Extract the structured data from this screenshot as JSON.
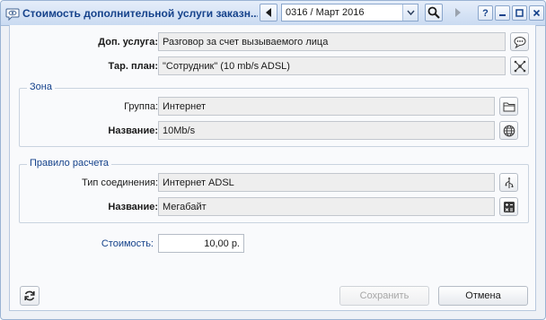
{
  "window": {
    "title": "Стоимость дополнительной услуги заказн...",
    "period_combo_value": "0316 / Март 2016",
    "help_label": "?"
  },
  "form": {
    "service_label": "Доп. услуга:",
    "service_value": "Разговор за счет вызываемого лица",
    "plan_label": "Тар. план:",
    "plan_value": "\"Сотрудник\" (10 mb/s ADSL)"
  },
  "zone": {
    "legend": "Зона",
    "group_label": "Группа:",
    "group_value": "Интернет",
    "name_label": "Название:",
    "name_value": "10Mb/s"
  },
  "rule": {
    "legend": "Правило расчета",
    "connection_label": "Тип соединения:",
    "connection_value": "Интернет ADSL",
    "name_label": "Название:",
    "name_value": "Мегабайт"
  },
  "cost": {
    "label": "Стоимость:",
    "value": "10,00 р."
  },
  "footer": {
    "save_label": "Сохранить",
    "cancel_label": "Отмена"
  },
  "icons": {
    "window": "speech-bubble-eye-icon",
    "prev": "arrow-left-icon",
    "next": "arrow-right-icon",
    "search": "magnifier-icon",
    "service": "speech-bubble-icon",
    "plan": "network-nodes-icon",
    "group": "folder-icon",
    "zone_name": "globe-icon",
    "connection": "usb-plug-icon",
    "rule_name": "calculator-icon",
    "refresh": "refresh-icon"
  },
  "colors": {
    "accent": "#15428b",
    "titlebar": "#c9daf1"
  }
}
